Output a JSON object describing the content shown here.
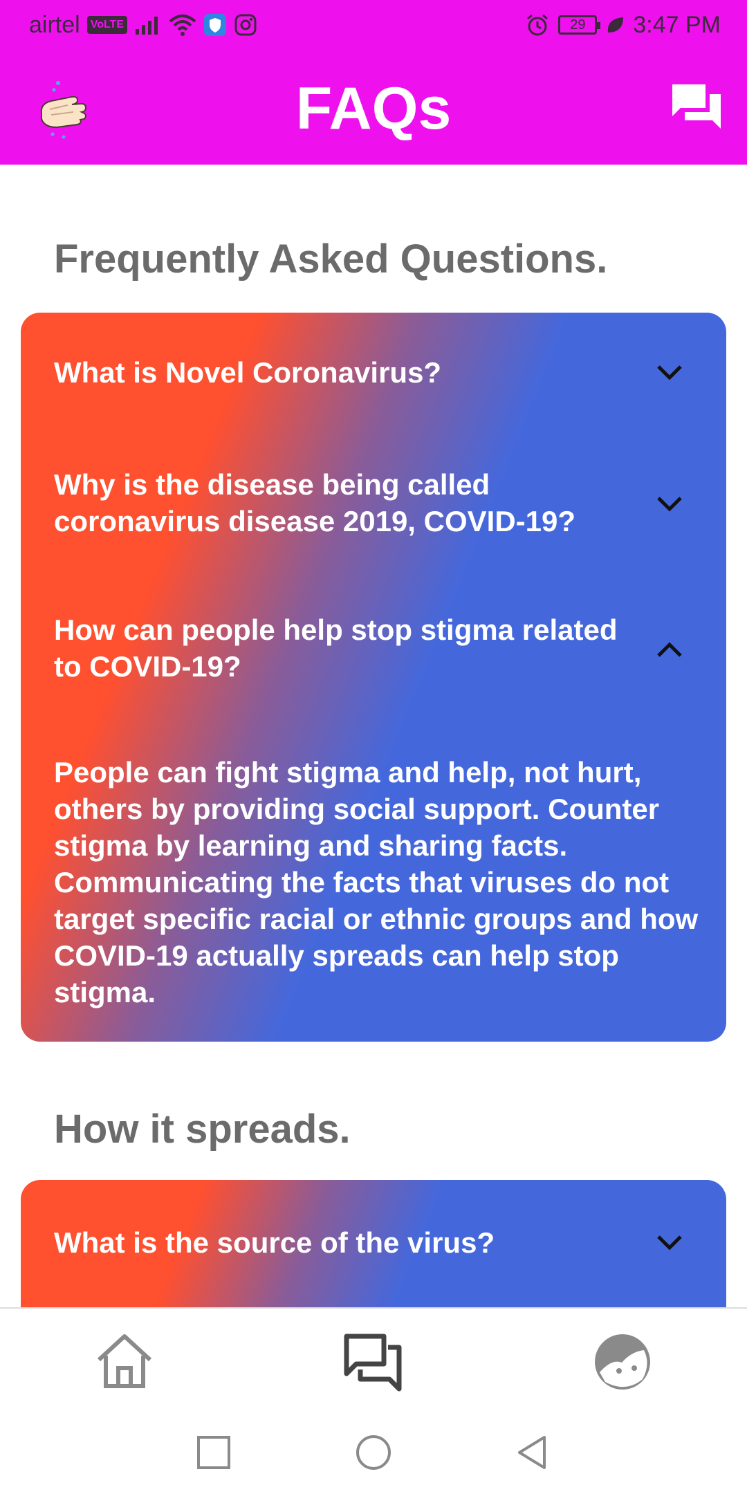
{
  "status_bar": {
    "carrier": "airtel",
    "volte": "VoLTE",
    "battery": "29",
    "time": "3:47 PM",
    "icons": [
      "signal-icon",
      "wifi-icon",
      "shield-icon",
      "instagram-icon",
      "alarm-icon",
      "battery-icon",
      "leaf-icon"
    ]
  },
  "app_bar": {
    "title": "FAQs",
    "left_icon": "handwash-logo-icon",
    "right_icon": "chat-icon"
  },
  "sections": [
    {
      "title": "Frequently Asked Questions.",
      "items": [
        {
          "question": "What is Novel Coronavirus?",
          "expanded": false
        },
        {
          "question": "Why is the disease being called coronavirus disease 2019, COVID-19?",
          "expanded": false
        },
        {
          "question": "How can people help stop stigma related to COVID-19?",
          "expanded": true,
          "answer": "People can fight stigma and help, not hurt, others by providing social support. Counter stigma by learning and sharing facts. Communicating the facts that viruses do not target specific racial or ethnic groups and how COVID-19 actually spreads can help stop stigma."
        }
      ]
    },
    {
      "title": "How it spreads.",
      "items": [
        {
          "question": "What is the source of the virus?",
          "expanded": false
        }
      ]
    }
  ],
  "bottom_nav": {
    "items": [
      {
        "icon": "home-icon",
        "active": false
      },
      {
        "icon": "chat-icon",
        "active": true
      },
      {
        "icon": "profile-face-icon",
        "active": false
      }
    ]
  },
  "colors": {
    "app_bar": "#ee11ee",
    "gradient_start": "#ff5030",
    "gradient_mid": "#8a5c98",
    "gradient_end": "#4468dc",
    "section_title": "#6b6b6b"
  }
}
